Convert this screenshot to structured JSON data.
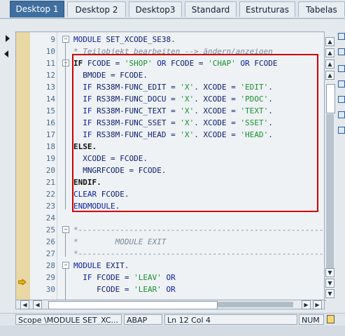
{
  "tabs": [
    "Desktop 1",
    "Desktop 2",
    "Desktop3",
    "Standard",
    "Estruturas",
    "Tabelas"
  ],
  "active_tab": 0,
  "lines": [
    {
      "n": "9",
      "parts": [
        [
          "kw",
          "MODULE"
        ],
        [
          "plain",
          " SET_XCODE_SE38."
        ]
      ]
    },
    {
      "n": "10",
      "parts": [
        [
          "cmt",
          "* Teilobjekt bearbeiten --> ändern/anzeigen"
        ]
      ]
    },
    {
      "n": "11",
      "parts": [
        [
          "dark",
          "IF"
        ],
        [
          "plain",
          " FCODE = "
        ],
        [
          "str",
          "'SHOP'"
        ],
        [
          "kw",
          " OR"
        ],
        [
          "plain",
          " FCODE = "
        ],
        [
          "str",
          "'CHAP'"
        ],
        [
          "kw",
          " OR"
        ],
        [
          "plain",
          " FCODE"
        ]
      ]
    },
    {
      "n": "12",
      "parts": [
        [
          "plain",
          "  BMODE = FCODE."
        ]
      ]
    },
    {
      "n": "13",
      "parts": [
        [
          "kw",
          "  IF"
        ],
        [
          "plain",
          " RS38M-FUNC_EDIT = "
        ],
        [
          "str",
          "'X'"
        ],
        [
          "plain",
          ". XCODE = "
        ],
        [
          "str",
          "'EDIT'"
        ],
        [
          "plain",
          "."
        ]
      ]
    },
    {
      "n": "14",
      "parts": [
        [
          "kw",
          "  IF"
        ],
        [
          "plain",
          " RS38M-FUNC_DOCU = "
        ],
        [
          "str",
          "'X'"
        ],
        [
          "plain",
          ". XCODE = "
        ],
        [
          "str",
          "'PDOC'"
        ],
        [
          "plain",
          "."
        ]
      ]
    },
    {
      "n": "15",
      "parts": [
        [
          "kw",
          "  IF"
        ],
        [
          "plain",
          " RS38M-FUNC_TEXT = "
        ],
        [
          "str",
          "'X'"
        ],
        [
          "plain",
          ". XCODE = "
        ],
        [
          "str",
          "'TEXT'"
        ],
        [
          "plain",
          "."
        ]
      ]
    },
    {
      "n": "16",
      "parts": [
        [
          "kw",
          "  IF"
        ],
        [
          "plain",
          " RS38M-FUNC_SSET = "
        ],
        [
          "str",
          "'X'"
        ],
        [
          "plain",
          ". XCODE = "
        ],
        [
          "str",
          "'SSET'"
        ],
        [
          "plain",
          "."
        ]
      ]
    },
    {
      "n": "17",
      "parts": [
        [
          "kw",
          "  IF"
        ],
        [
          "plain",
          " RS38M-FUNC_HEAD = "
        ],
        [
          "str",
          "'X'"
        ],
        [
          "plain",
          ". XCODE = "
        ],
        [
          "str",
          "'HEAD'"
        ],
        [
          "plain",
          "."
        ]
      ]
    },
    {
      "n": "18",
      "parts": [
        [
          "dark",
          "ELSE."
        ]
      ]
    },
    {
      "n": "19",
      "parts": [
        [
          "plain",
          "  XCODE = FCODE."
        ]
      ]
    },
    {
      "n": "20",
      "parts": [
        [
          "plain",
          "  MNGRFCODE = FCODE."
        ]
      ]
    },
    {
      "n": "21",
      "parts": [
        [
          "dark",
          "ENDIF."
        ]
      ]
    },
    {
      "n": "22",
      "parts": [
        [
          "kw",
          "CLEAR"
        ],
        [
          "plain",
          " FCODE."
        ]
      ]
    },
    {
      "n": "23",
      "parts": [
        [
          "kw",
          "ENDMODULE"
        ],
        [
          "plain",
          "."
        ]
      ]
    },
    {
      "n": "24",
      "parts": []
    },
    {
      "n": "25",
      "parts": [
        [
          "cmt",
          "*----------------------------------------------------------"
        ]
      ]
    },
    {
      "n": "26",
      "parts": [
        [
          "cmt",
          "*        MODULE EXIT"
        ]
      ]
    },
    {
      "n": "27",
      "parts": [
        [
          "cmt",
          "*----------------------------------------------------------"
        ]
      ]
    },
    {
      "n": "28",
      "parts": [
        [
          "kw",
          "MODULE"
        ],
        [
          "plain",
          " EXIT."
        ]
      ]
    },
    {
      "n": "29",
      "parts": [
        [
          "kw",
          "  IF"
        ],
        [
          "plain",
          " FCODE = "
        ],
        [
          "str",
          "'LEAV'"
        ],
        [
          "kw",
          " OR"
        ]
      ]
    },
    {
      "n": "30",
      "parts": [
        [
          "plain",
          "     FCODE = "
        ],
        [
          "str",
          "'LEAR'"
        ],
        [
          "kw",
          " OR"
        ]
      ]
    }
  ],
  "status": {
    "scope": "Scope \\MODULE SET_XC...",
    "lang": "ABAP",
    "pos": "Ln  12 Col   4",
    "mode": "NUM"
  }
}
